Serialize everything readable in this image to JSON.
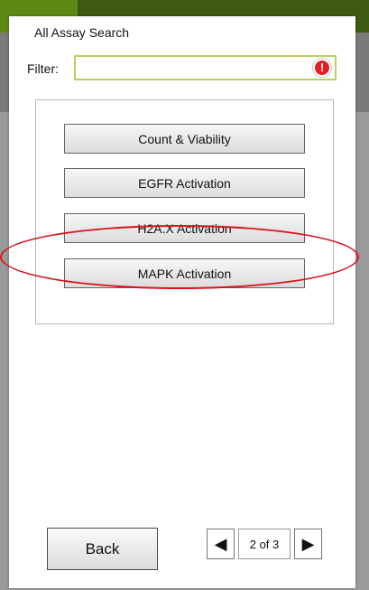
{
  "dialog": {
    "title": "All Assay Search",
    "filter": {
      "label": "Filter:",
      "value": "",
      "placeholder": "",
      "icon": "warning-icon",
      "icon_glyph": "!"
    },
    "assays": [
      {
        "label": "Count & Viability"
      },
      {
        "label": "EGFR Activation"
      },
      {
        "label": "H2A.X Activation"
      },
      {
        "label": "MAPK Activation"
      }
    ],
    "highlighted_item": "MAPK Activation",
    "back_label": "Back",
    "pagination": {
      "current": 2,
      "total": 3,
      "text": "2 of 3",
      "prev_glyph": "◀",
      "next_glyph": "▶"
    }
  },
  "colors": {
    "top_bar": "#3e5a12",
    "top_accent": "#5d8a14",
    "filter_border": "#b6d35e",
    "warning": "#e51e24",
    "highlight_ellipse": "#d9141c"
  }
}
